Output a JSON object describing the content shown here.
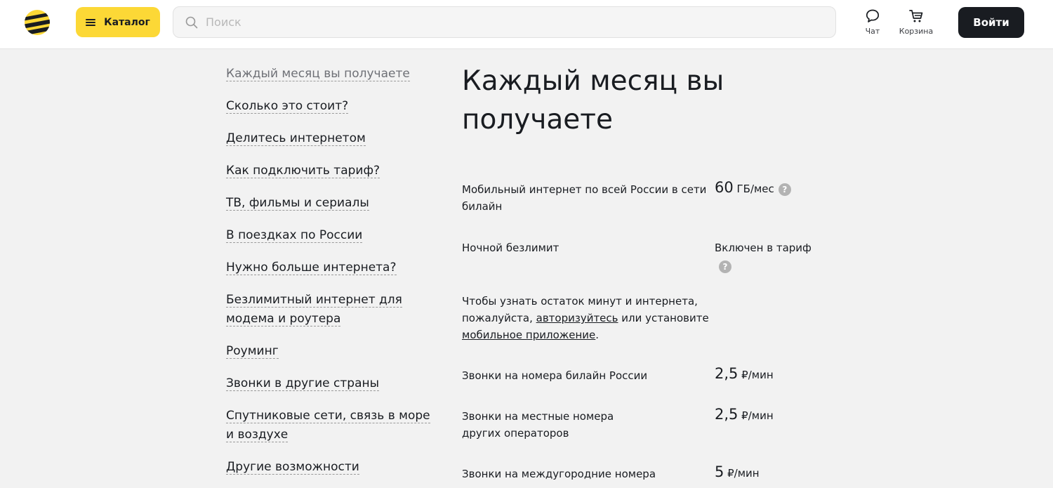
{
  "header": {
    "catalog_label": "Каталог",
    "search_placeholder": "Поиск",
    "chat_label": "Чат",
    "cart_label": "Корзина",
    "login_label": "Войти"
  },
  "colors": {
    "brand_yellow": "#fcd836",
    "dark": "#191c21",
    "background": "#f2f2f2"
  },
  "nav": {
    "items": [
      {
        "label": "Каждый месяц вы получаете",
        "active": true
      },
      {
        "label": "Сколько это стоит?"
      },
      {
        "label": "Делитесь интернетом"
      },
      {
        "label": "Как подключить тариф?"
      },
      {
        "label": "ТВ, фильмы и сериалы"
      },
      {
        "label": "В поездках по России"
      },
      {
        "label": "Нужно больше интернета?"
      },
      {
        "label": "Безлимитный интернет для модема и роутера"
      },
      {
        "label": "Роуминг"
      },
      {
        "label": "Звонки в другие страны"
      },
      {
        "label": "Спутниковые сети, связь в море и воздухе"
      },
      {
        "label": "Другие возможности"
      }
    ]
  },
  "main": {
    "title": "Каждый месяц вы получаете",
    "internet": {
      "name": "Мобильный интернет по всей России в сети билайн",
      "value": "60",
      "unit": " ГБ/мес"
    },
    "night": {
      "name": "Ночной безлимит",
      "value": "Включен в тариф"
    },
    "note": {
      "before": "Чтобы узнать остаток минут и интернета, пожалуйста, ",
      "link1": "авторизуйтесь",
      "middle": " или установите ",
      "link2": "мобильное приложение",
      "after": "."
    },
    "calls": [
      {
        "name": "Звонки на номера билайн России",
        "value": "2,5",
        "unit": " ₽/мин"
      },
      {
        "name": "Звонки на местные номера других операторов",
        "value": "2,5",
        "unit": " ₽/мин"
      },
      {
        "name": "Звонки на междугородние номера других операторов",
        "value": "5",
        "unit": " ₽/мин"
      }
    ]
  },
  "help_icon_glyph": "?"
}
